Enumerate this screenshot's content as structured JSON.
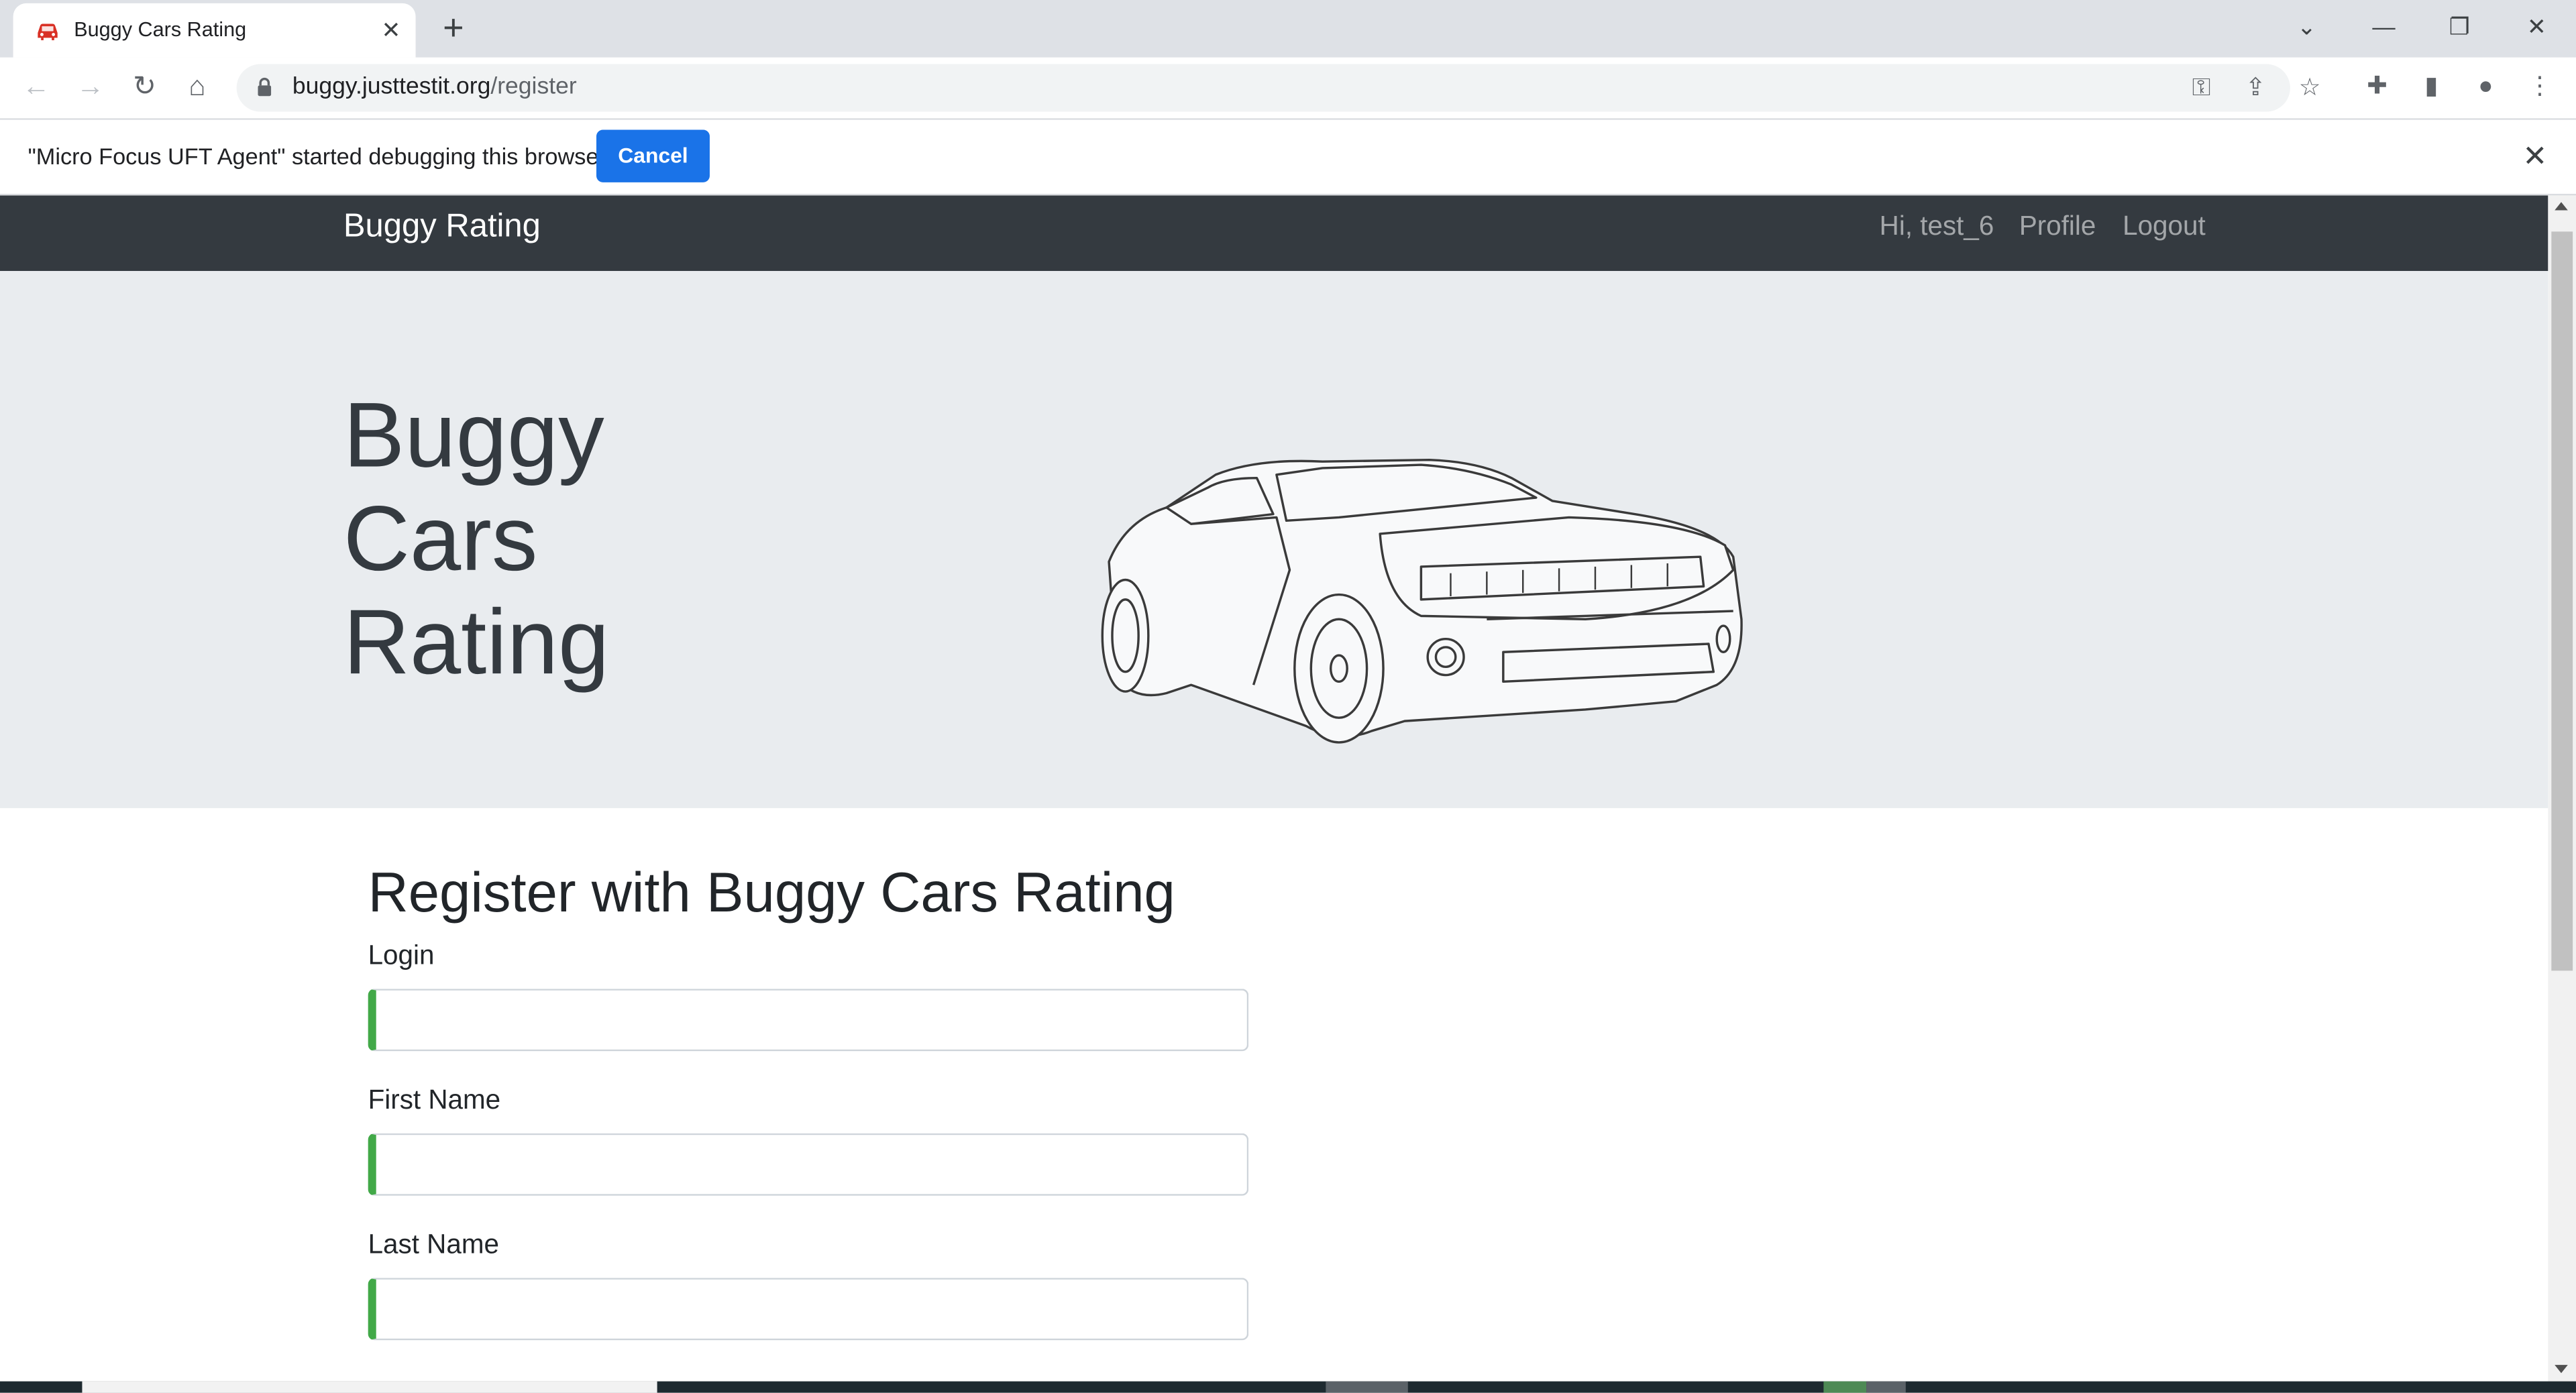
{
  "browser": {
    "tab_title": "Buggy Cars Rating",
    "new_tab_glyph": "+",
    "tab_close_glyph": "✕",
    "url_host": "buggy.justtestit.org",
    "url_path": "/register",
    "window_controls": {
      "dropdown": "⌄",
      "minimize": "—",
      "restore": "❐",
      "close": "✕"
    },
    "icons": [
      "back-icon",
      "forward-icon",
      "reload-icon",
      "home-icon",
      "lock-icon",
      "key-icon",
      "share-icon",
      "star-icon",
      "extensions-icon",
      "side-panel-icon",
      "profile-icon",
      "menu-icon"
    ]
  },
  "infobar": {
    "message": "\"Micro Focus UFT Agent\" started debugging this browser",
    "cancel_label": "Cancel",
    "close_glyph": "✕"
  },
  "site": {
    "brand": "Buggy Rating",
    "greeting": "Hi, test_6",
    "profile_link": "Profile",
    "logout_link": "Logout",
    "hero_title_line1": "Buggy",
    "hero_title_line2": "Cars",
    "hero_title_line3": "Rating",
    "register_heading": "Register with Buggy Cars Rating",
    "form": {
      "login_label": "Login",
      "login_value": "",
      "first_name_label": "First Name",
      "first_name_value": "",
      "last_name_label": "Last Name",
      "last_name_value": ""
    }
  },
  "colors": {
    "navbar_bg": "#343a40",
    "jumbotron_bg": "#e9ecef",
    "cancel_button_bg": "#1a73e8",
    "valid_input_accent": "#42a948"
  }
}
